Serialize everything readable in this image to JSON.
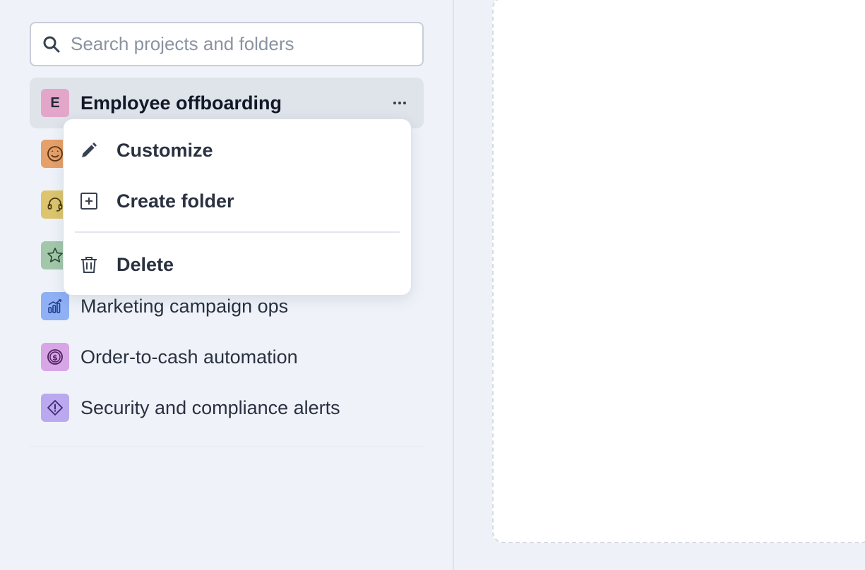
{
  "search": {
    "placeholder": "Search projects and folders",
    "value": ""
  },
  "projects": [
    {
      "label": "Employee offboarding",
      "avatar_letter": "E",
      "avatar_color": "#e3a6c9",
      "icon": "letter",
      "active": true
    },
    {
      "label": "",
      "avatar_color": "#e6a06a",
      "icon": "star-eyes-face-icon",
      "active": false
    },
    {
      "label": "",
      "avatar_color": "#dcc56e",
      "icon": "headset-icon",
      "active": false
    },
    {
      "label": "",
      "avatar_color": "#a2c7a9",
      "icon": "star-icon",
      "active": false
    },
    {
      "label": "Marketing campaign ops",
      "avatar_color": "#8fb0f5",
      "icon": "chart-growth-icon",
      "active": false
    },
    {
      "label": "Order-to-cash automation",
      "avatar_color": "#d7a6e6",
      "icon": "dollar-coin-icon",
      "active": false
    },
    {
      "label": "Security and compliance alerts",
      "avatar_color": "#bba8ee",
      "icon": "alert-diamond-icon",
      "active": false
    }
  ],
  "menu": {
    "items": [
      {
        "label": "Customize",
        "icon": "pencil-icon"
      },
      {
        "label": "Create folder",
        "icon": "plus-square-icon"
      },
      {
        "label": "Delete",
        "icon": "trash-icon"
      }
    ]
  }
}
